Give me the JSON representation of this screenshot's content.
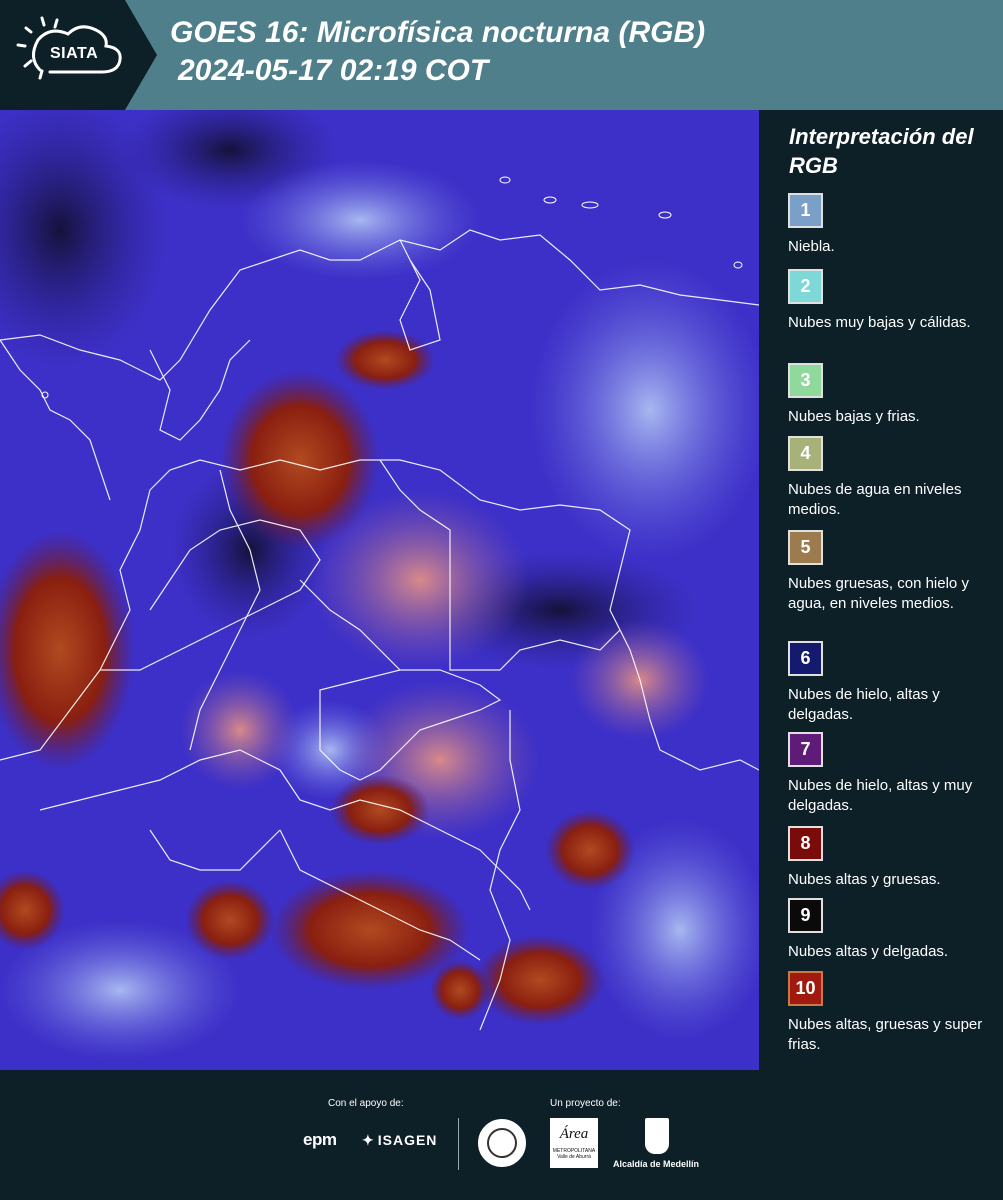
{
  "header": {
    "logo_text": "SIATA",
    "title_line1": "GOES 16: Microfísica nocturna (RGB)",
    "title_line2": "2024-05-17 02:19 COT"
  },
  "map": {
    "description_icon": "satellite-rgb-image"
  },
  "legend": {
    "title": "Interpretación del RGB",
    "items": [
      {
        "number": "1",
        "label": "Niebla.",
        "color": "#7ba0c8"
      },
      {
        "number": "2",
        "label": "Nubes muy bajas y cálidas.",
        "color": "#7ed8d8"
      },
      {
        "number": "3",
        "label": "Nubes bajas y frias.",
        "color": "#8ed99b"
      },
      {
        "number": "4",
        "label": "Nubes de agua en niveles medios.",
        "color": "#a7b27a"
      },
      {
        "number": "5",
        "label": "Nubes gruesas, con hielo y agua, en niveles medios.",
        "color": "#9c7b4f"
      },
      {
        "number": "6",
        "label": "Nubes de hielo, altas y delgadas.",
        "color": "#141a6e"
      },
      {
        "number": "7",
        "label": "Nubes de hielo, altas y muy delgadas.",
        "color": "#5e1c78"
      },
      {
        "number": "8",
        "label": "Nubes altas y gruesas.",
        "color": "#7a0b0b"
      },
      {
        "number": "9",
        "label": "Nubes altas y delgadas.",
        "color": "#0a0a0a"
      },
      {
        "number": "10",
        "label": "Nubes altas, gruesas y super frias.",
        "color": "#a01a10"
      }
    ]
  },
  "footer": {
    "support_label": "Con el apoyo de:",
    "project_label": "Un proyecto de:",
    "epm": "epm",
    "isagen": "ISAGEN",
    "area_logo": "Área",
    "area_sub": "METROPOLITANA Valle de Aburrá",
    "alcaldia": "Alcaldía de Medellín"
  }
}
